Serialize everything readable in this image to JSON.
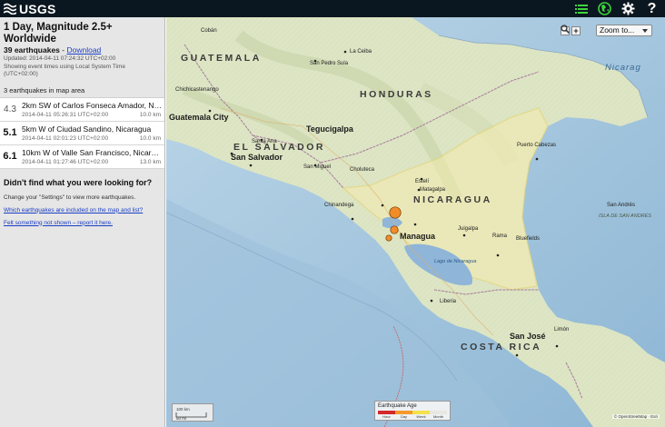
{
  "header": {
    "logo": "USGS",
    "icons": [
      "list-icon",
      "map-icon",
      "settings-icon",
      "help-icon"
    ],
    "help_label": "?"
  },
  "summary": {
    "title": "1 Day, Magnitude 2.5+ Worldwide",
    "count": "39 earthquakes",
    "separator": " - ",
    "download": "Download",
    "updated": "Updated: 2014-04-11 07:24:32 UTC+02:00",
    "timezone_note": "Showing event times using Local System Time (UTC+02:00)",
    "in_map_area": "3 earthquakes in map area"
  },
  "earthquakes": [
    {
      "mag": "4.3",
      "place": "2km SW of Carlos Fonseca Amador, Nic…",
      "time": "2014-04-11 05:26:31 UTC+02:00",
      "depth": "10.0 km"
    },
    {
      "mag": "5.1",
      "place": "5km W of Ciudad Sandino, Nicaragua",
      "time": "2014-04-11 02:01:23 UTC+02:00",
      "depth": "10.0 km"
    },
    {
      "mag": "6.1",
      "place": "10km W of Valle San Francisco, Nicaragua",
      "time": "2014-04-11 01:27:46 UTC+02:00",
      "depth": "13.0 km"
    }
  ],
  "footer": {
    "heading": "Didn't find what you were looking for?",
    "settings_hint": "Change your \"Settings\" to view more earthquakes.",
    "link_included": "Which earthquakes are included on the map and list?",
    "link_report": "Felt something not shown – report it here."
  },
  "map": {
    "zoom_in": "+",
    "zoom_out": "−",
    "zoom_select": "Zoom to...",
    "scale_top": "100 km",
    "scale_bottom": "50 mi",
    "legend_title": "Earthquake Age",
    "legend_ticks": [
      "Hour",
      "Day",
      "Week",
      "Month"
    ],
    "legend_colors": [
      "#d4282a",
      "#f59a2a",
      "#f4e24a",
      "#e8e8e0"
    ],
    "attribution": "© OpenStreetMap · Esri",
    "labels": {
      "guatemala": "GUATEMALA",
      "honduras": "HONDURAS",
      "el_salvador": "EL SALVADOR",
      "nicaragua": "NICARAGUA",
      "costa_rica": "COSTA RICA",
      "guatemala_city": "Guatemala City",
      "tegucigalpa": "Tegucigalpa",
      "san_salvador": "San Salvador",
      "managua": "Managua",
      "san_jose": "San José",
      "san_pedro_sula": "San Pedro Sula",
      "la_ceiba": "La Ceiba",
      "chichicastenango": "Chichicastenango",
      "cobán": "Cobán",
      "santa_ana": "Santa Ana",
      "san_miguel": "San Miguel",
      "choluteca": "Choluteca",
      "esteli": "Estelí",
      "matagalpa": "Matagalpa",
      "chinandega": "Chinandega",
      "juigalpa": "Juigalpa",
      "rama": "Rama",
      "bluefields": "Bluefields",
      "puerto_cabezas": "Puerto Cabezas",
      "liberia": "Liberia",
      "limon": "Limón",
      "san_andres": "San Andrés",
      "lago_nicaragua": "Lago de Nicaragua",
      "nicaragua_sea": "Nicarag",
      "isla_de_san_andres": "ISLA DE SAN ANDRÉS"
    }
  }
}
